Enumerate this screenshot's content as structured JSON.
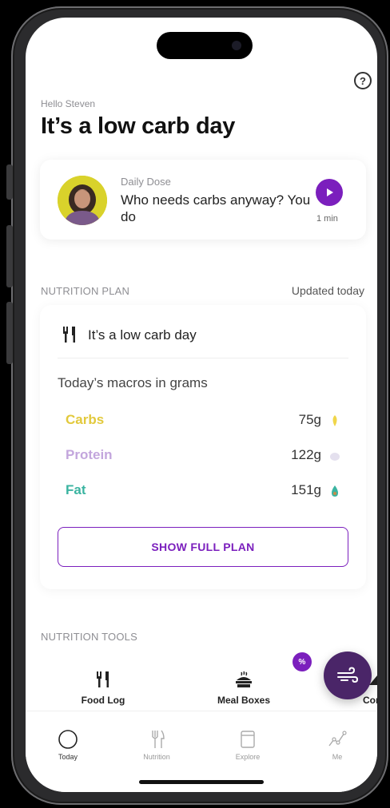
{
  "header": {
    "greeting": "Hello Steven",
    "title": "It’s a low carb day",
    "help_icon": "question-circle-icon"
  },
  "daily_dose": {
    "label": "Daily Dose",
    "text": "Who needs carbs anyway? You do",
    "duration": "1 min",
    "play_icon": "play-icon"
  },
  "nutrition_plan": {
    "section_label": "NUTRITION PLAN",
    "updated": "Updated today",
    "plan_name": "It’s a low carb day",
    "macros_heading": "Today’s macros in grams",
    "macros": [
      {
        "name": "Carbs",
        "value": "75g",
        "color": "#e2c93c",
        "icon": "grain-icon"
      },
      {
        "name": "Protein",
        "value": "122g",
        "color": "#c3a6dd",
        "icon": "egg-icon"
      },
      {
        "name": "Fat",
        "value": "151g",
        "color": "#3bb4a1",
        "icon": "avocado-icon"
      }
    ],
    "show_plan_label": "SHOW FULL PLAN"
  },
  "nutrition_tools": {
    "section_label": "NUTRITION TOOLS",
    "items": [
      {
        "label": "Food Log",
        "icon": "cutlery-icon"
      },
      {
        "label": "Meal Boxes",
        "icon": "meal-box-icon"
      },
      {
        "label": "Con",
        "icon": "more-tools-icon"
      }
    ],
    "badge": "%"
  },
  "tab_bar": {
    "tabs": [
      {
        "label": "Today",
        "icon": "circle-icon",
        "active": true
      },
      {
        "label": "Nutrition",
        "icon": "cutlery-icon",
        "active": false
      },
      {
        "label": "Explore",
        "icon": "explore-icon",
        "active": false
      },
      {
        "label": "Me",
        "icon": "trend-chart-icon",
        "active": false
      }
    ]
  },
  "colors": {
    "accent": "#7b1fbd",
    "fab": "#4a2568"
  }
}
